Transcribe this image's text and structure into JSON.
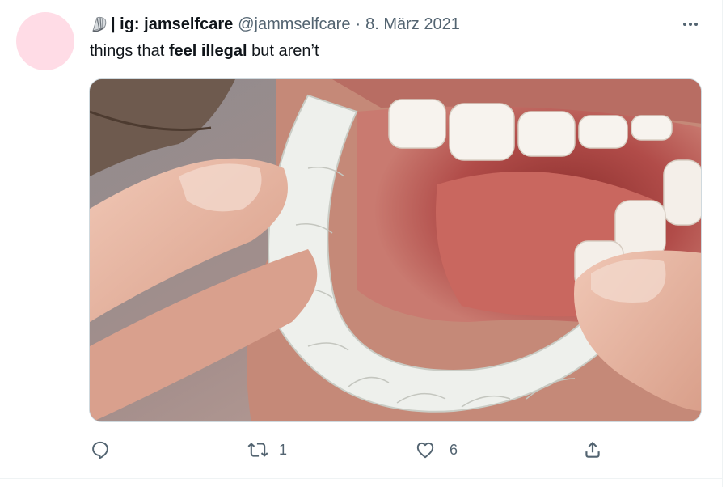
{
  "tweet": {
    "display_name": "| ig: jamselfcare",
    "handle": "@jammselfcare",
    "separator": "·",
    "date": "8. März 2021",
    "text_parts": [
      "things that ",
      "feel illegal",
      " but aren’t"
    ],
    "avatar_color": "#ffdce6",
    "name_icon": "shell-icon",
    "media_description_icon": "photo"
  },
  "actions": {
    "reply": {
      "icon": "reply-icon",
      "count": ""
    },
    "retweet": {
      "icon": "retweet-icon",
      "count": "1"
    },
    "like": {
      "icon": "heart-icon",
      "count": "6"
    },
    "share": {
      "icon": "share-icon",
      "count": ""
    }
  },
  "colors": {
    "text_primary": "#0f1419",
    "text_secondary": "#536471",
    "border": "#cfd9de"
  }
}
